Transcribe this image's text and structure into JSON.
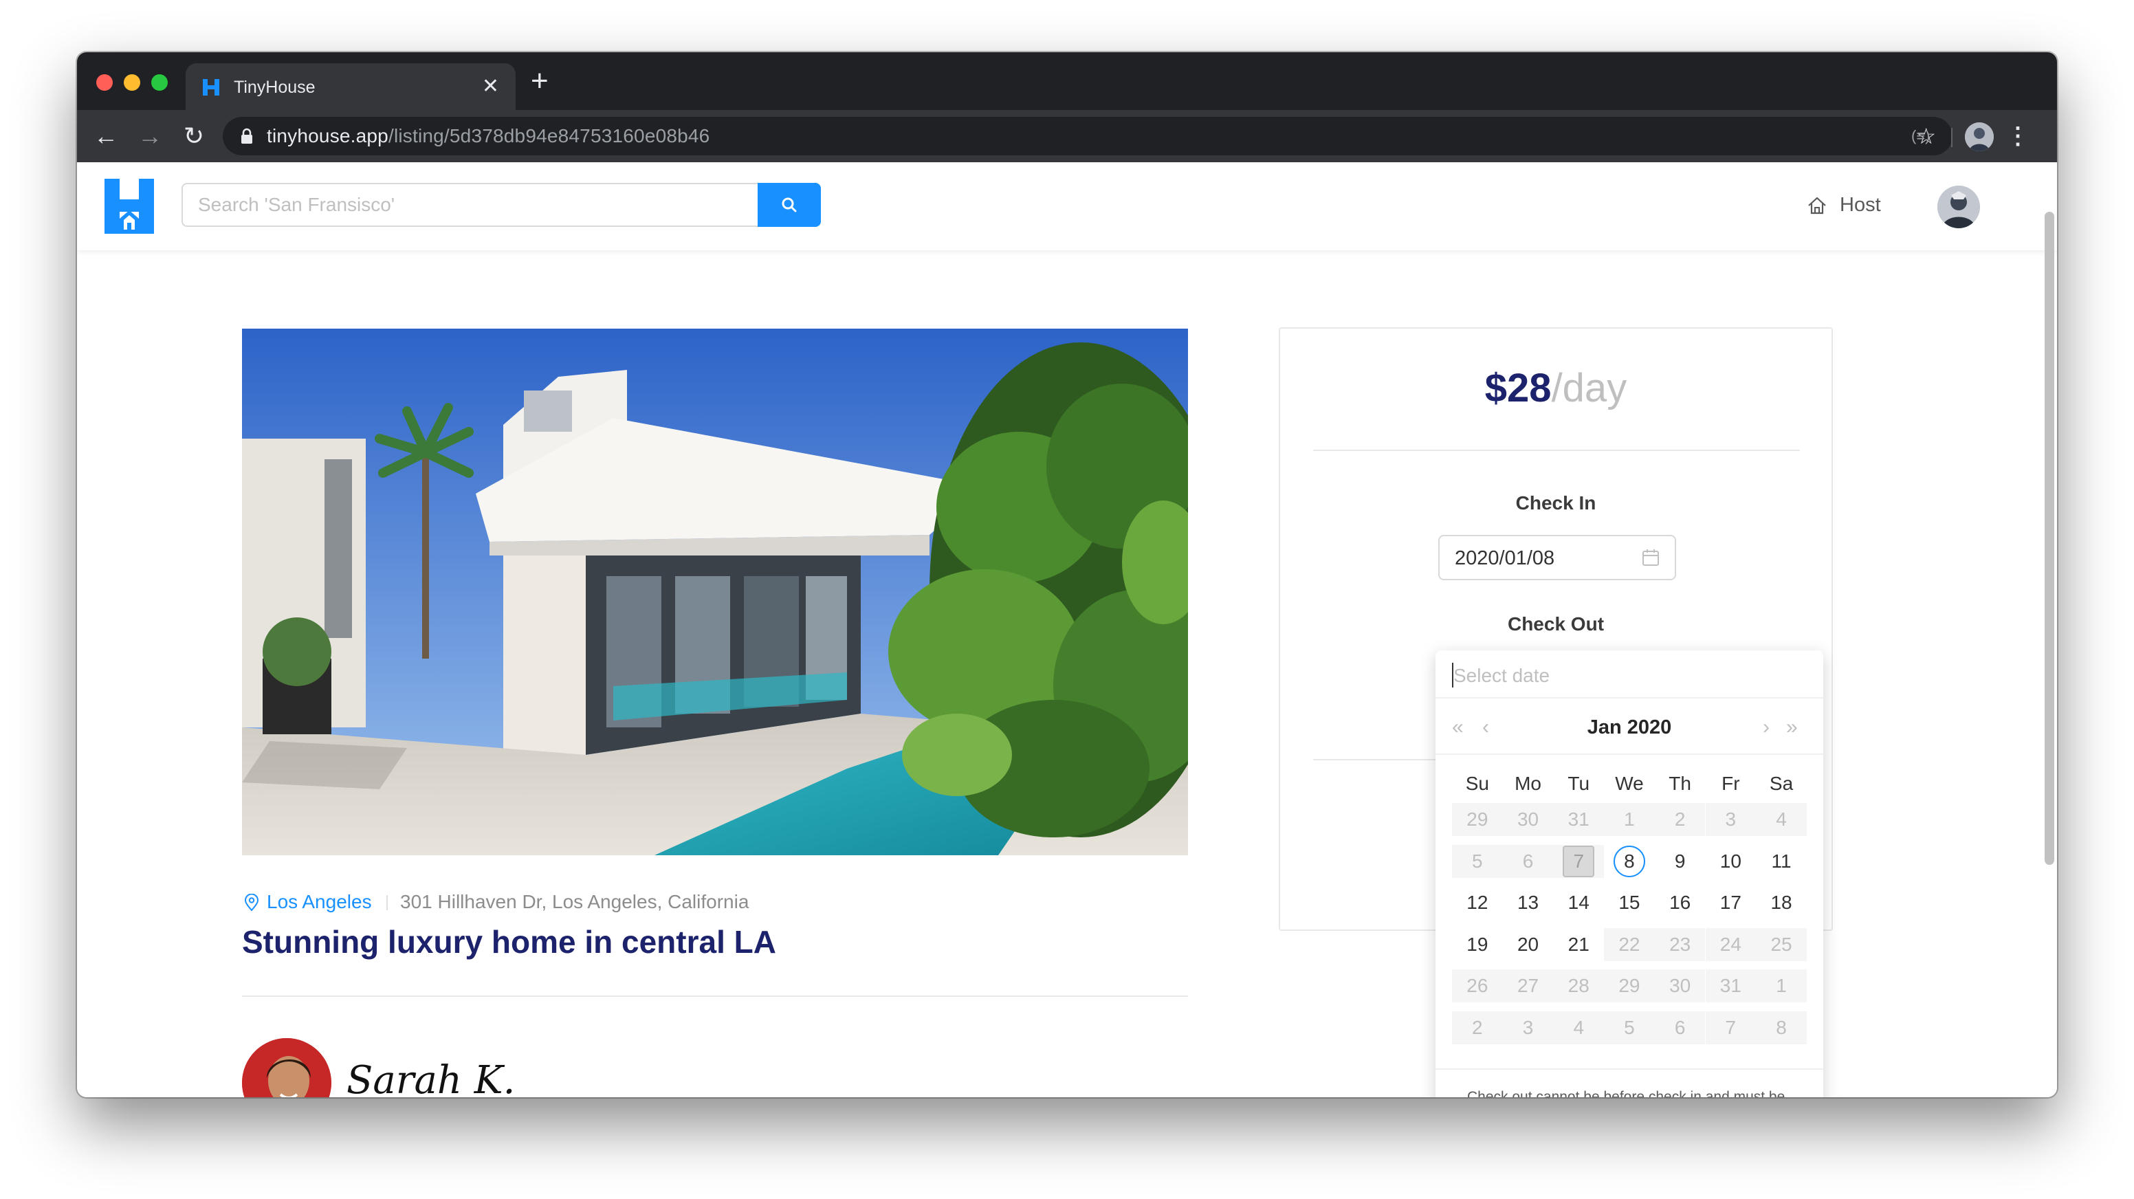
{
  "browser": {
    "tab_title": "TinyHouse",
    "tab_close": "✕",
    "new_tab": "+",
    "url_host": "tinyhouse.app",
    "url_path": "/listing/5d378db94e84753160e08b46",
    "back": "←",
    "forward": "→",
    "reload": "↻",
    "star": "☆",
    "ext": "(≡)",
    "menu": "⋮"
  },
  "header": {
    "search_placeholder": "Search 'San Fransisco'",
    "host_label": "Host"
  },
  "listing": {
    "city": "Los Angeles",
    "address": "301 Hillhaven Dr, Los Angeles, California",
    "title": "Stunning luxury home in central LA",
    "host_name": "Sarah K."
  },
  "booking": {
    "price": "$28",
    "price_unit": "/day",
    "check_in_label": "Check In",
    "check_in_value": "2020/01/08",
    "check_out_label": "Check Out"
  },
  "date_picker": {
    "placeholder": "Select date",
    "month_label": "Jan 2020",
    "prev_year": "«",
    "prev_month": "‹",
    "next_month": "›",
    "next_year": "»",
    "weekdays": [
      "Su",
      "Mo",
      "Tu",
      "We",
      "Th",
      "Fr",
      "Sa"
    ],
    "weeks": [
      [
        "29",
        "30",
        "31",
        "1",
        "2",
        "3",
        "4"
      ],
      [
        "5",
        "6",
        "7",
        "8",
        "9",
        "10",
        "11"
      ],
      [
        "12",
        "13",
        "14",
        "15",
        "16",
        "17",
        "18"
      ],
      [
        "19",
        "20",
        "21",
        "22",
        "23",
        "24",
        "25"
      ],
      [
        "26",
        "27",
        "28",
        "29",
        "30",
        "31",
        "1"
      ],
      [
        "2",
        "3",
        "4",
        "5",
        "6",
        "7",
        "8"
      ]
    ],
    "disabled": [
      [
        true,
        true,
        true,
        true,
        true,
        true,
        true
      ],
      [
        true,
        true,
        true,
        false,
        false,
        false,
        false
      ],
      [
        false,
        false,
        false,
        false,
        false,
        false,
        false
      ],
      [
        false,
        false,
        false,
        true,
        true,
        true,
        true
      ],
      [
        true,
        true,
        true,
        true,
        true,
        true,
        true
      ],
      [
        true,
        true,
        true,
        true,
        true,
        true,
        true
      ]
    ],
    "selected_day": "7",
    "today_day": "8",
    "footer_note": "Check out cannot be before check in and must be within a suitable range of dates."
  },
  "colors": {
    "brand_blue": "#1890ff",
    "title_navy": "#1d226c"
  }
}
